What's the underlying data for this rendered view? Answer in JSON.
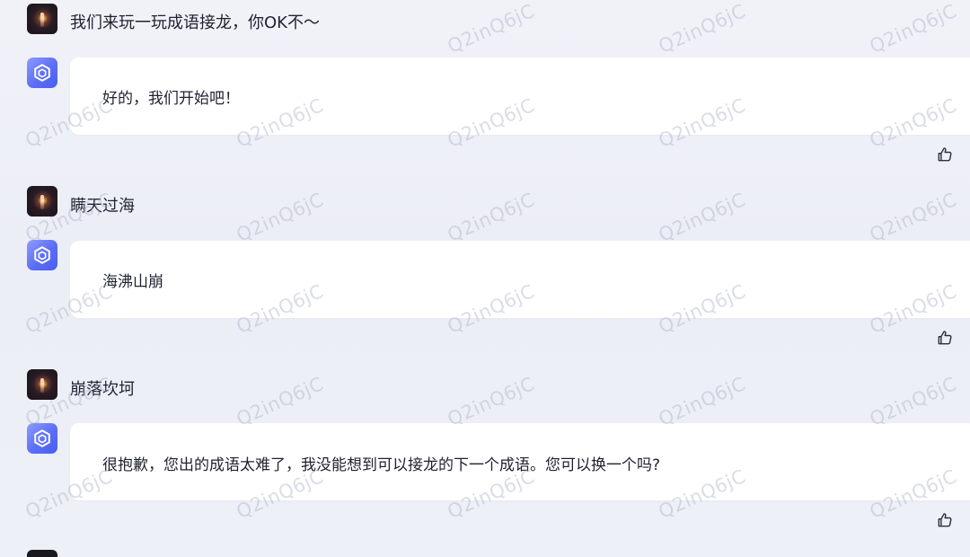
{
  "conversation": {
    "messages": [
      {
        "role": "user",
        "text": "我们来玩一玩成语接龙，你OK不～"
      },
      {
        "role": "assistant",
        "text": "好的，我们开始吧！"
      },
      {
        "role": "user",
        "text": "瞒天过海"
      },
      {
        "role": "assistant",
        "text": "海沸山崩"
      },
      {
        "role": "user",
        "text": "崩落坎坷"
      },
      {
        "role": "assistant",
        "text": "很抱歉，您出的成语太难了，我没能想到可以接龙的下一个成语。您可以换一个吗?"
      }
    ]
  },
  "icons": {
    "user_avatar": "user-avatar-image",
    "bot_avatar": "hexagon-cube-logo-icon",
    "like": "thumbs-up-icon"
  },
  "watermark": {
    "text": "Q2inQ6jC"
  },
  "colors": {
    "background": "#eef0f7",
    "bubble": "#ffffff",
    "bot_avatar": "#5b6ef5",
    "text": "#1e2230"
  }
}
